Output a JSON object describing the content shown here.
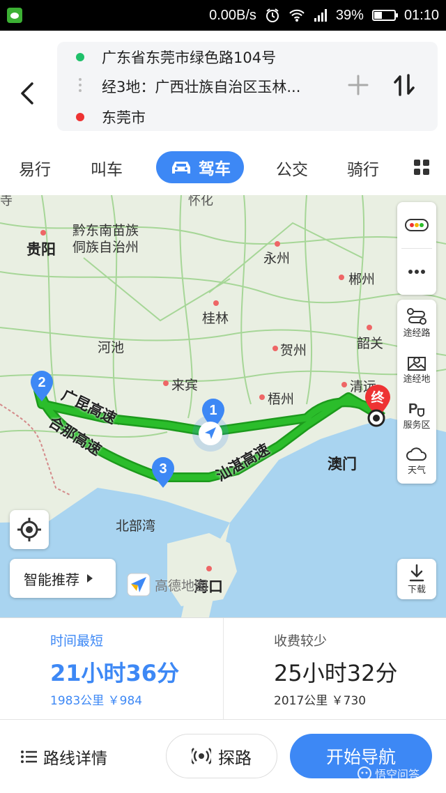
{
  "status_bar": {
    "speed": "0.00B/s",
    "battery": "39%",
    "battery_level": 0.39,
    "time": "01:10"
  },
  "route": {
    "origin": "广东省东莞市绿色路104号",
    "waypoints": "经3地：广西壮族自治区玉林...",
    "destination": "东莞市",
    "origin_color": "#1fc06a",
    "destination_color": "#ee3333"
  },
  "tabs": [
    {
      "label": "易行"
    },
    {
      "label": "叫车"
    },
    {
      "label": "驾车",
      "active": true
    },
    {
      "label": "公交"
    },
    {
      "label": "骑行"
    }
  ],
  "map": {
    "cities": [
      "贵阳",
      "黔东南苗族",
      "侗族自治州",
      "永州",
      "郴州",
      "桂林",
      "河池",
      "贺州",
      "韶关",
      "来宾",
      "梧州",
      "清远",
      "澳门",
      "北部湾",
      "海口",
      "怀化"
    ],
    "highways": [
      "广昆高速",
      "合那高速",
      "汕湛高速"
    ],
    "markers": {
      "wp1": "1",
      "wp2": "2",
      "wp3": "3",
      "end": "终"
    },
    "side_panel": {
      "waypoint_road": "途经路",
      "waypoint_place": "途经地",
      "service_area": "服务区",
      "weather": "天气"
    },
    "smart_recommend": "智能推荐",
    "download": "下载",
    "brand": "高德地图",
    "route_color": "#2bbd2b"
  },
  "cards": [
    {
      "title": "时间最短",
      "duration": "21小时36分",
      "meta": "1983公里  ￥984",
      "selected": true
    },
    {
      "title": "收费较少",
      "duration": "25小时32分",
      "meta": "2017公里  ￥730",
      "selected": false
    }
  ],
  "bottom": {
    "detail": "路线详情",
    "probe": "探路",
    "navigate": "开始导航",
    "watermark": "悟空问答"
  },
  "accent_color": "#3d88f5"
}
